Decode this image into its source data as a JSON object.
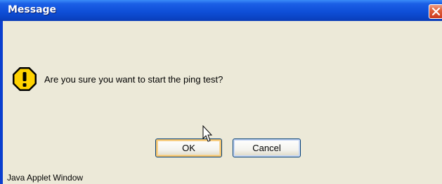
{
  "window": {
    "title": "Message",
    "status_text": "Java Applet Window"
  },
  "dialog": {
    "message": "Are you sure you want to start the ping test?",
    "icon": "warning-icon"
  },
  "buttons": {
    "ok_label": "OK",
    "cancel_label": "Cancel"
  },
  "colors": {
    "titlebar": "#0f4fd8",
    "dialog_background": "#ece9d8",
    "close_button": "#e0603a",
    "warning_fill": "#ffd200"
  }
}
